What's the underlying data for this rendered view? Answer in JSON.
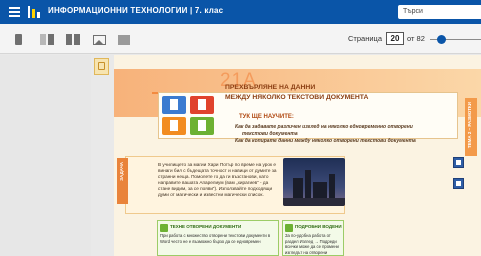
{
  "app": {
    "title": "ИНФОРМАЦИОННИ ТЕХНОЛОГИИ | 7. клас",
    "search_placeholder": "Търси",
    "accent_color": "#0a55a8"
  },
  "toolbar": {
    "icons": [
      "single-page-icon",
      "two-page-icon",
      "two-page-alt-icon",
      "image-icon",
      "fullscreen-icon"
    ],
    "page_label": "Страница",
    "page_value": "20",
    "page_total": "от 82"
  },
  "page": {
    "lesson_number": "21А",
    "title_line1": "ПРЕХВЪРЛЯНЕ НА ДАННИ",
    "title_line2": "МЕЖДУ НЯКОЛКО ТЕКСТОВИ ДОКУМЕНТА",
    "learn_heading": "ТУК ЩЕ НАУЧИТЕ:",
    "learn_items": [
      "Как да задавате различен изглед на няколко едновременно отворени",
      "текстови документа",
      "Как да копирате данни между няколко отворени текстови документа"
    ],
    "side_tab": "ТЕМА 2 – РАЗМОТКИ",
    "left_tab": "ЗАДАЧА",
    "intro_text": "В училището за магии Хари Потър по време на урок е винаги бил с бъдещата точност и навици от думите за странни неща. Помолете го да ги възстанови, като направите вашата Апарелиум (вам „хирагиев“ - да стане видим, за се появи“). Използвайте подходящи думи от магически и известни магически список.",
    "box1_title": "ТЕХНЕ ОТВОРЕНИ ДОКУМЕНТИ",
    "box1_text": "При работа с множество отворени текстови документи в Word често не е възможно бързо да се едновремен",
    "box2_title": "ПОДРОБНИ ВОДЕНИ",
    "box2_text": "За по-удобна работа от раздел Изглед → Подреди всички може да се промени изгледът на отворени"
  }
}
